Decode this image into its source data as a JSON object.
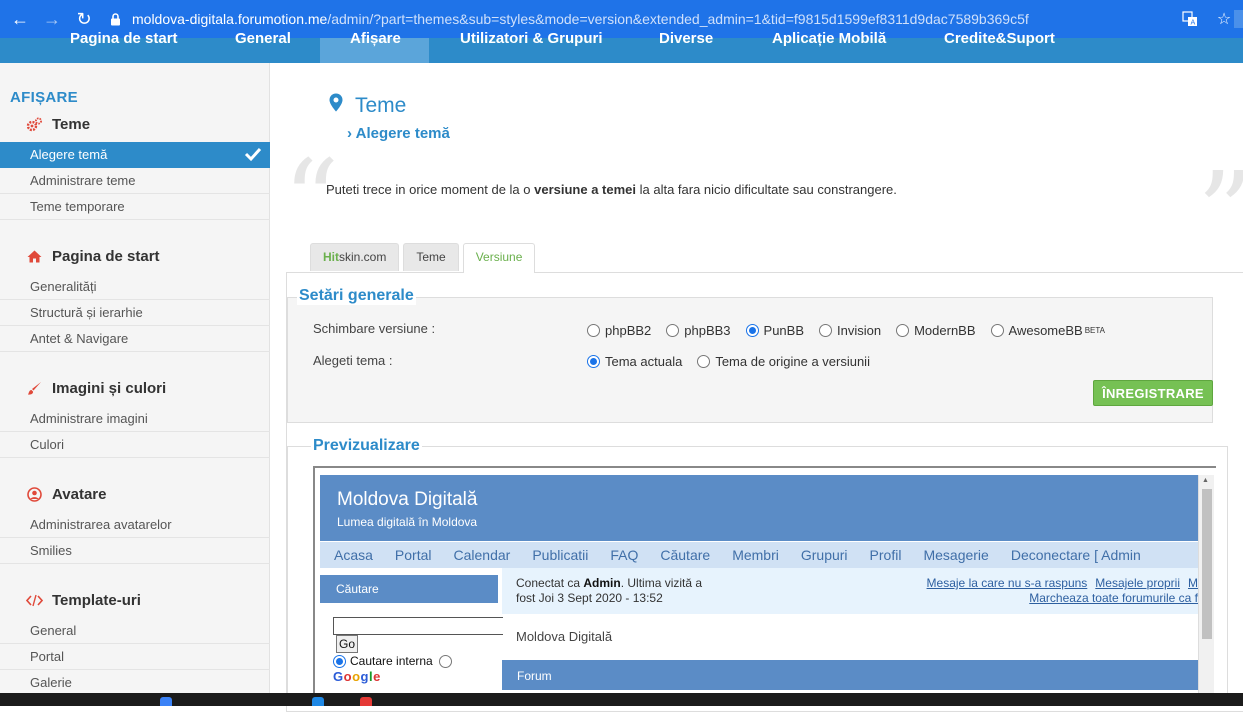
{
  "browser": {
    "url_host": "moldova-digitala.forumotion.me",
    "url_path": "/admin/?part=themes&sub=styles&mode=version&extended_admin=1&tid=f9815d1599ef8311d9dac7589b369c5f"
  },
  "topnav": {
    "items": [
      "Pagina de start",
      "General",
      "Afișare",
      "Utilizatori & Grupuri",
      "Diverse",
      "Aplicație Mobilă",
      "Credite&Suport"
    ]
  },
  "sidebar": {
    "heading": "AFIȘARE",
    "sections": [
      {
        "title": "Teme",
        "icon": "gears-icon",
        "items": [
          "Alegere temă",
          "Administrare teme",
          "Teme temporare"
        ]
      },
      {
        "title": "Pagina de start",
        "icon": "home-icon",
        "items": [
          "Generalități",
          "Structură și ierarhie",
          "Antet & Navigare"
        ]
      },
      {
        "title": "Imagini și culori",
        "icon": "brush-icon",
        "items": [
          "Administrare imagini",
          "Culori"
        ]
      },
      {
        "title": "Avatare",
        "icon": "user-circle-icon",
        "items": [
          "Administrarea avatarelor",
          "Smilies"
        ]
      },
      {
        "title": "Template-uri",
        "icon": "code-icon",
        "items": [
          "General",
          "Portal",
          "Galerie"
        ]
      }
    ]
  },
  "page": {
    "title": "Teme",
    "subtitle": "Alegere temă",
    "intro_before": "Puteti trece in orice moment de la o ",
    "intro_bold": "versiune a temei",
    "intro_after": " la alta fara nicio dificultate sau constrangere."
  },
  "tabs": {
    "hitskin_hit": "Hit",
    "hitskin_rest": "skin.com",
    "teme": "Teme",
    "versiune": "Versiune"
  },
  "settings": {
    "legend": "Setări generale",
    "version_label": "Schimbare versiune :",
    "versions": [
      "phpBB2",
      "phpBB3",
      "PunBB",
      "Invision",
      "ModernBB",
      "AwesomeBB"
    ],
    "version_beta": "BETA",
    "selected_version": "PunBB",
    "theme_label": "Alegeti tema :",
    "themes": [
      "Tema actuala",
      "Tema de origine a versiunii"
    ],
    "selected_theme": "Tema actuala",
    "save_label": "ÎNREGISTRARE"
  },
  "preview": {
    "legend": "Previzualizare",
    "site_title": "Moldova Digitală",
    "site_desc": "Lumea digitală în Moldova",
    "nav": [
      "Acasa",
      "Portal",
      "Calendar",
      "Publicatii",
      "FAQ",
      "Căutare",
      "Membri",
      "Grupuri",
      "Profil",
      "Mesagerie",
      "Deconectare [ Admin"
    ],
    "search_head": "Căutare",
    "go_label": "Go",
    "search_option": "Cautare interna",
    "google": [
      "G",
      "o",
      "o",
      "g",
      "l",
      "e"
    ],
    "connected_prefix": "Conectat ca ",
    "connected_user": "Admin",
    "connected_suffix": ". Ultima vizită a",
    "connected_line2": "fost Joi 3 Sept 2020 - 13:52",
    "link_unanswered": "Mesaje la care nu s-a raspuns",
    "link_own": "Mesajele proprii",
    "link_more": "M",
    "link_markread": "Marcheaza toate forumurile ca f",
    "breadcrumb": "Moldova Digitală",
    "forum_head": "Forum"
  },
  "colors": {
    "accent": "#2d8bc9",
    "browser_bar": "#1f73e8",
    "save_green": "#76c154",
    "preview_blue": "#5b8cc6"
  }
}
